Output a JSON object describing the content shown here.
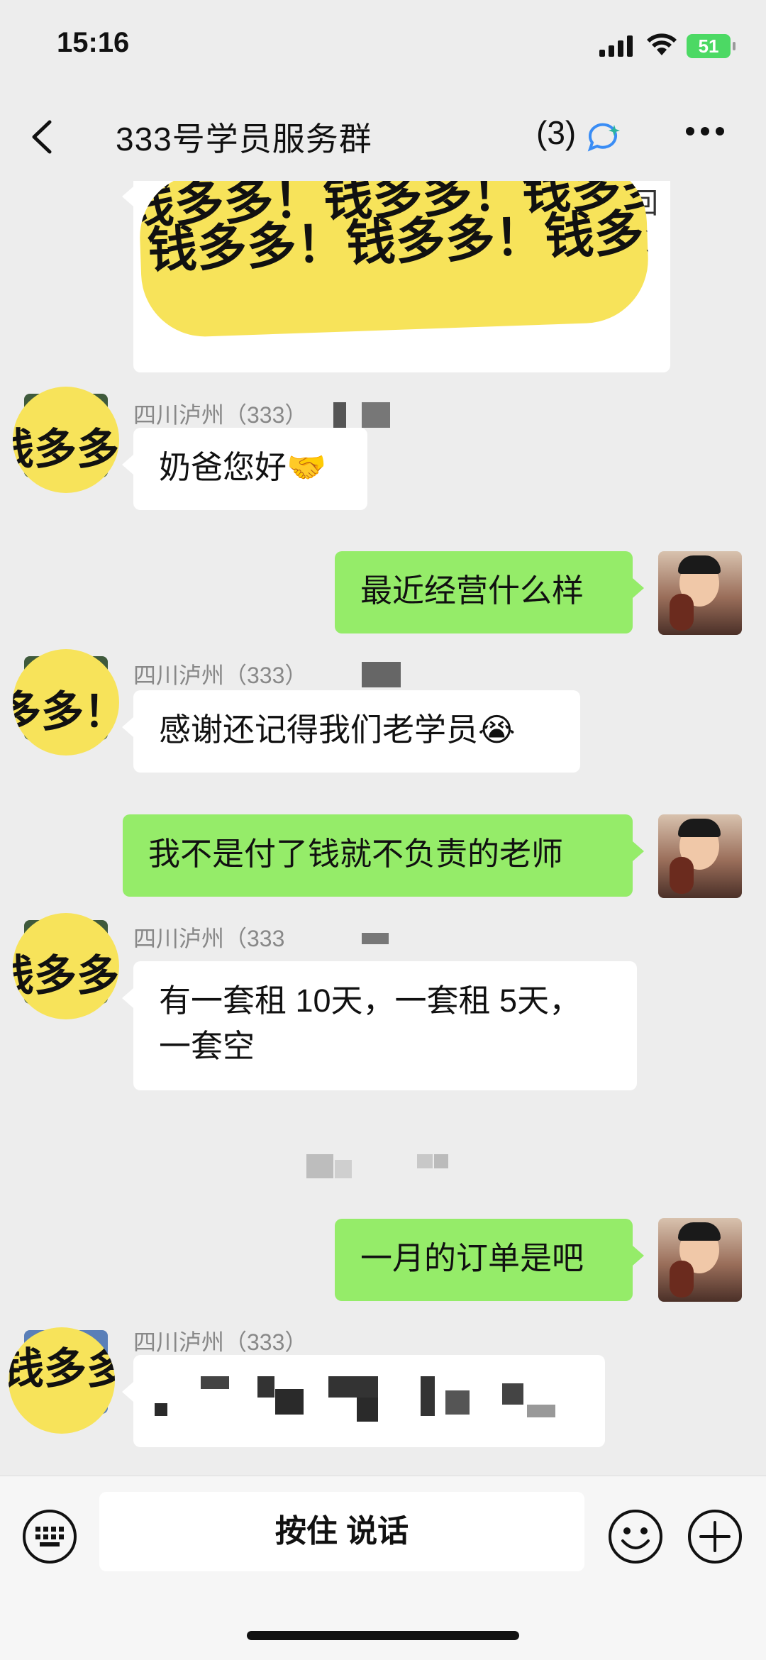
{
  "status_bar": {
    "time": "15:16",
    "battery": "51"
  },
  "nav": {
    "title": "333号学员服务群",
    "member_count": "(3)"
  },
  "top_card": {
    "visible_text": "佛系回"
  },
  "watermark_text": "钱多多！钱多多！钱多多！钱多多！",
  "messages": [
    {
      "sender": "四川泸州（333）",
      "text": "奶爸您好🤝"
    },
    {
      "text": "最近经营什么样"
    },
    {
      "sender": "四川泸州（333）",
      "text": "感谢还记得我们老学员😭"
    },
    {
      "text": "我不是付了钱就不负责的老师"
    },
    {
      "sender": "四川泸州（333",
      "line1": "有一套租 10天，一套租 5天，",
      "line2": "一套空"
    },
    {
      "text": "一月的订单是吧"
    },
    {
      "sender": "四川泸州（333）"
    }
  ],
  "input_bar": {
    "voice_label": "按住 说话"
  },
  "icons": [
    "back-chevron-icon",
    "ai-chat-icon",
    "more-dots-icon",
    "keyboard-icon",
    "emoji-icon",
    "plus-icon"
  ]
}
